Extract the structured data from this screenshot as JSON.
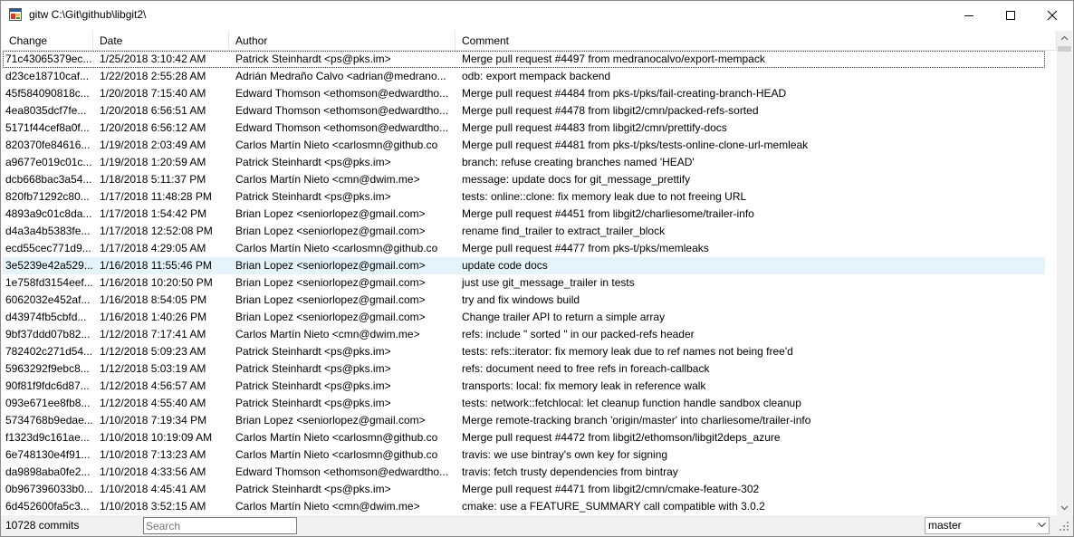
{
  "window": {
    "title": "gitw C:\\Git\\github\\libgit2\\"
  },
  "columns": [
    "Change",
    "Date",
    "Author",
    "Comment"
  ],
  "commits": [
    [
      "71c43065379ec...",
      "1/25/2018 3:10:42 AM",
      "Patrick Steinhardt <ps@pks.im>",
      "Merge pull request #4497 from medranocalvo/export-mempack"
    ],
    [
      "d23ce18710caf...",
      "1/22/2018 2:55:28 AM",
      "Adrián Medraño Calvo <adrian@medrano...",
      "odb: export mempack backend"
    ],
    [
      "45f584090818c...",
      "1/20/2018 7:15:40 AM",
      "Edward Thomson <ethomson@edwardtho...",
      "Merge pull request #4484 from pks-t/pks/fail-creating-branch-HEAD"
    ],
    [
      "4ea8035dcf7fe...",
      "1/20/2018 6:56:51 AM",
      "Edward Thomson <ethomson@edwardtho...",
      "Merge pull request #4478 from libgit2/cmn/packed-refs-sorted"
    ],
    [
      "5171f44cef8a0f...",
      "1/20/2018 6:56:12 AM",
      "Edward Thomson <ethomson@edwardtho...",
      "Merge pull request #4483 from libgit2/cmn/prettify-docs"
    ],
    [
      "820370fe84616...",
      "1/19/2018 2:03:49 AM",
      "Carlos Martín Nieto <carlosmn@github.co",
      "Merge pull request #4481 from pks-t/pks/tests-online-clone-url-memleak"
    ],
    [
      "a9677e019c01c...",
      "1/19/2018 1:20:59 AM",
      "Patrick Steinhardt <ps@pks.im>",
      "branch: refuse creating branches named 'HEAD'"
    ],
    [
      "dcb668bac3a54...",
      "1/18/2018 5:11:37 PM",
      "Carlos Martín Nieto <cmn@dwim.me>",
      "message: update docs for git_message_prettify"
    ],
    [
      "820fb71292c80...",
      "1/17/2018 11:48:28 PM",
      "Patrick Steinhardt <ps@pks.im>",
      "tests: online::clone: fix memory leak due to not freeing URL"
    ],
    [
      "4893a9c01c8da...",
      "1/17/2018 1:54:42 PM",
      "Brian Lopez <seniorlopez@gmail.com>",
      "Merge pull request #4451 from libgit2/charliesome/trailer-info"
    ],
    [
      "d4a3a4b5383fe...",
      "1/17/2018 12:52:08 PM",
      "Brian Lopez <seniorlopez@gmail.com>",
      "rename find_trailer to extract_trailer_block"
    ],
    [
      "ecd55cec771d9...",
      "1/17/2018 4:29:05 AM",
      "Carlos Martín Nieto <carlosmn@github.co",
      "Merge pull request #4477 from pks-t/pks/memleaks"
    ],
    [
      "3e5239e42a529...",
      "1/16/2018 11:55:46 PM",
      "Brian Lopez <seniorlopez@gmail.com>",
      "update code docs"
    ],
    [
      "1e758fd3154eef...",
      "1/16/2018 10:20:50 PM",
      "Brian Lopez <seniorlopez@gmail.com>",
      "just use git_message_trailer in tests"
    ],
    [
      "6062032e452af...",
      "1/16/2018 8:54:05 PM",
      "Brian Lopez <seniorlopez@gmail.com>",
      "try and fix windows build"
    ],
    [
      "d43974fb5cbfd...",
      "1/16/2018 1:40:26 PM",
      "Brian Lopez <seniorlopez@gmail.com>",
      "Change trailer API to return a simple array"
    ],
    [
      "9bf37ddd07b82...",
      "1/12/2018 7:17:41 AM",
      "Carlos Martín Nieto <cmn@dwim.me>",
      "refs: include \" sorted \" in our packed-refs header"
    ],
    [
      "782402c271d54...",
      "1/12/2018 5:09:23 AM",
      "Patrick Steinhardt <ps@pks.im>",
      "tests: refs::iterator: fix memory leak due to ref names not being free'd"
    ],
    [
      "5963292f9ebc8...",
      "1/12/2018 5:03:19 AM",
      "Patrick Steinhardt <ps@pks.im>",
      "refs: document need to free refs in foreach-callback"
    ],
    [
      "90f81f9fdc6d87...",
      "1/12/2018 4:56:57 AM",
      "Patrick Steinhardt <ps@pks.im>",
      "transports: local: fix memory leak in reference walk"
    ],
    [
      "093e671ee8fb8...",
      "1/12/2018 4:55:40 AM",
      "Patrick Steinhardt <ps@pks.im>",
      "tests: network::fetchlocal: let cleanup function handle sandbox cleanup"
    ],
    [
      "5734768b9edae...",
      "1/10/2018 7:19:34 PM",
      "Brian Lopez <seniorlopez@gmail.com>",
      "Merge remote-tracking branch 'origin/master' into charliesome/trailer-info"
    ],
    [
      "f1323d9c161ae...",
      "1/10/2018 10:19:09 AM",
      "Carlos Martín Nieto <carlosmn@github.co",
      "Merge pull request #4472 from libgit2/ethomson/libgit2deps_azure"
    ],
    [
      "6e748130e4f91...",
      "1/10/2018 7:13:23 AM",
      "Carlos Martín Nieto <carlosmn@github.co",
      "travis: we use bintray's own key for signing"
    ],
    [
      "da9898aba0fe2...",
      "1/10/2018 4:33:56 AM",
      "Edward Thomson <ethomson@edwardtho...",
      "travis: fetch trusty dependencies from bintray"
    ],
    [
      "0b967396033b0...",
      "1/10/2018 4:45:41 AM",
      "Patrick Steinhardt <ps@pks.im>",
      "Merge pull request #4471 from libgit2/cmn/cmake-feature-302"
    ],
    [
      "6d452600fa5c3...",
      "1/10/2018 3:52:15 AM",
      "Carlos Martín Nieto <cmn@dwim.me>",
      "cmake: use a FEATURE_SUMMARY call compatible with 3.0.2"
    ]
  ],
  "selection": {
    "current_row": 0,
    "hover_row": 12
  },
  "status": {
    "count": "10728 commits",
    "search_placeholder": "Search",
    "branch": "master"
  },
  "icons": {
    "app": "app-icon",
    "minimize": "minimize-icon",
    "maximize": "maximize-icon",
    "close": "close-icon",
    "scroll_up": "scroll-up-icon",
    "scroll_down": "scroll-down-icon",
    "dropdown": "chevron-down-icon",
    "grip": "size-grip-icon"
  },
  "colors": {
    "hover_row": "#e5f3fb",
    "statusbar": "#f0f0f0",
    "scrollbar": "#f0f0f0"
  }
}
